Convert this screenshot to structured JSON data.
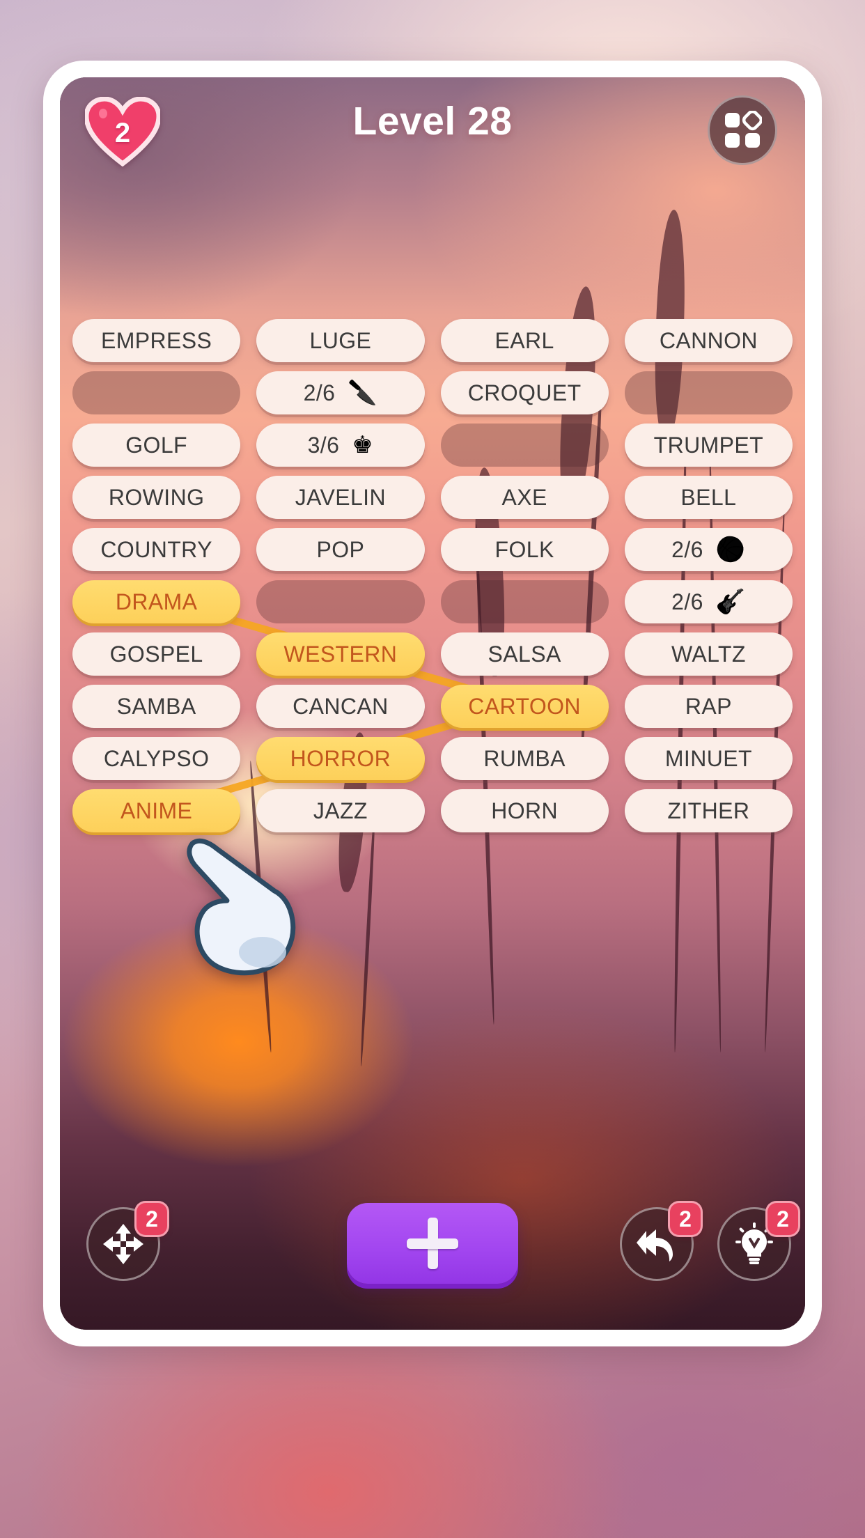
{
  "header": {
    "lives_count": "2",
    "title": "Level 28",
    "heart_icon": "heart-icon",
    "menu_icon": "grid-menu-icon"
  },
  "colors": {
    "tile_bg": "#fbeee8",
    "tile_text": "#3b3b3b",
    "selected_bg": "#fdd05a",
    "selected_text": "#c2561d",
    "badge": "#e8415f",
    "add_button": "#a347f0",
    "connector": "#f5a623"
  },
  "grid": {
    "columns": 4,
    "rows": 10,
    "tiles": [
      {
        "type": "word",
        "label": "EMPRESS",
        "state": "normal"
      },
      {
        "type": "word",
        "label": "LUGE",
        "state": "normal"
      },
      {
        "type": "word",
        "label": "EARL",
        "state": "normal"
      },
      {
        "type": "word",
        "label": "CANNON",
        "state": "normal"
      },
      {
        "type": "empty",
        "label": "",
        "state": "empty"
      },
      {
        "type": "count",
        "label": "2/6",
        "glyph": "🔪",
        "icon": "knife-icon",
        "state": "normal"
      },
      {
        "type": "word",
        "label": "CROQUET",
        "state": "normal"
      },
      {
        "type": "empty",
        "label": "",
        "state": "empty"
      },
      {
        "type": "word",
        "label": "GOLF",
        "state": "normal"
      },
      {
        "type": "count",
        "label": "3/6",
        "glyph": "♚",
        "icon": "crown-icon",
        "state": "normal"
      },
      {
        "type": "empty",
        "label": "",
        "state": "empty"
      },
      {
        "type": "word",
        "label": "TRUMPET",
        "state": "normal"
      },
      {
        "type": "word",
        "label": "ROWING",
        "state": "normal"
      },
      {
        "type": "word",
        "label": "JAVELIN",
        "state": "normal"
      },
      {
        "type": "word",
        "label": "AXE",
        "state": "normal"
      },
      {
        "type": "word",
        "label": "BELL",
        "state": "normal"
      },
      {
        "type": "word",
        "label": "COUNTRY",
        "state": "normal"
      },
      {
        "type": "word",
        "label": "POP",
        "state": "normal"
      },
      {
        "type": "word",
        "label": "FOLK",
        "state": "normal"
      },
      {
        "type": "count",
        "label": "2/6",
        "glyph": "🏀",
        "icon": "basketball-icon",
        "state": "normal"
      },
      {
        "type": "word",
        "label": "DRAMA",
        "state": "selected"
      },
      {
        "type": "empty",
        "label": "",
        "state": "empty"
      },
      {
        "type": "empty",
        "label": "",
        "state": "empty"
      },
      {
        "type": "count",
        "label": "2/6",
        "glyph": "🎸",
        "icon": "guitar-icon",
        "state": "normal"
      },
      {
        "type": "word",
        "label": "GOSPEL",
        "state": "normal"
      },
      {
        "type": "word",
        "label": "WESTERN",
        "state": "selected"
      },
      {
        "type": "word",
        "label": "SALSA",
        "state": "normal"
      },
      {
        "type": "word",
        "label": "WALTZ",
        "state": "normal"
      },
      {
        "type": "word",
        "label": "SAMBA",
        "state": "normal"
      },
      {
        "type": "word",
        "label": "CANCAN",
        "state": "normal"
      },
      {
        "type": "word",
        "label": "CARTOON",
        "state": "selected"
      },
      {
        "type": "word",
        "label": "RAP",
        "state": "normal"
      },
      {
        "type": "word",
        "label": "CALYPSO",
        "state": "normal"
      },
      {
        "type": "word",
        "label": "HORROR",
        "state": "selected"
      },
      {
        "type": "word",
        "label": "RUMBA",
        "state": "normal"
      },
      {
        "type": "word",
        "label": "MINUET",
        "state": "normal"
      },
      {
        "type": "word",
        "label": "ANIME",
        "state": "selected"
      },
      {
        "type": "word",
        "label": "JAZZ",
        "state": "normal"
      },
      {
        "type": "word",
        "label": "HORN",
        "state": "normal"
      },
      {
        "type": "word",
        "label": "ZITHER",
        "state": "normal"
      }
    ],
    "selection_path": [
      "DRAMA",
      "WESTERN",
      "CARTOON",
      "HORROR",
      "ANIME"
    ]
  },
  "toolbar": {
    "shuffle": {
      "icon": "move-arrows-icon",
      "badge": "2"
    },
    "add": {
      "icon": "plus-icon",
      "label": ""
    },
    "undo": {
      "icon": "undo-arrow-icon",
      "badge": "2"
    },
    "hint": {
      "icon": "lightbulb-icon",
      "badge": "2"
    }
  },
  "cursor": {
    "icon": "pointing-hand-cursor"
  }
}
